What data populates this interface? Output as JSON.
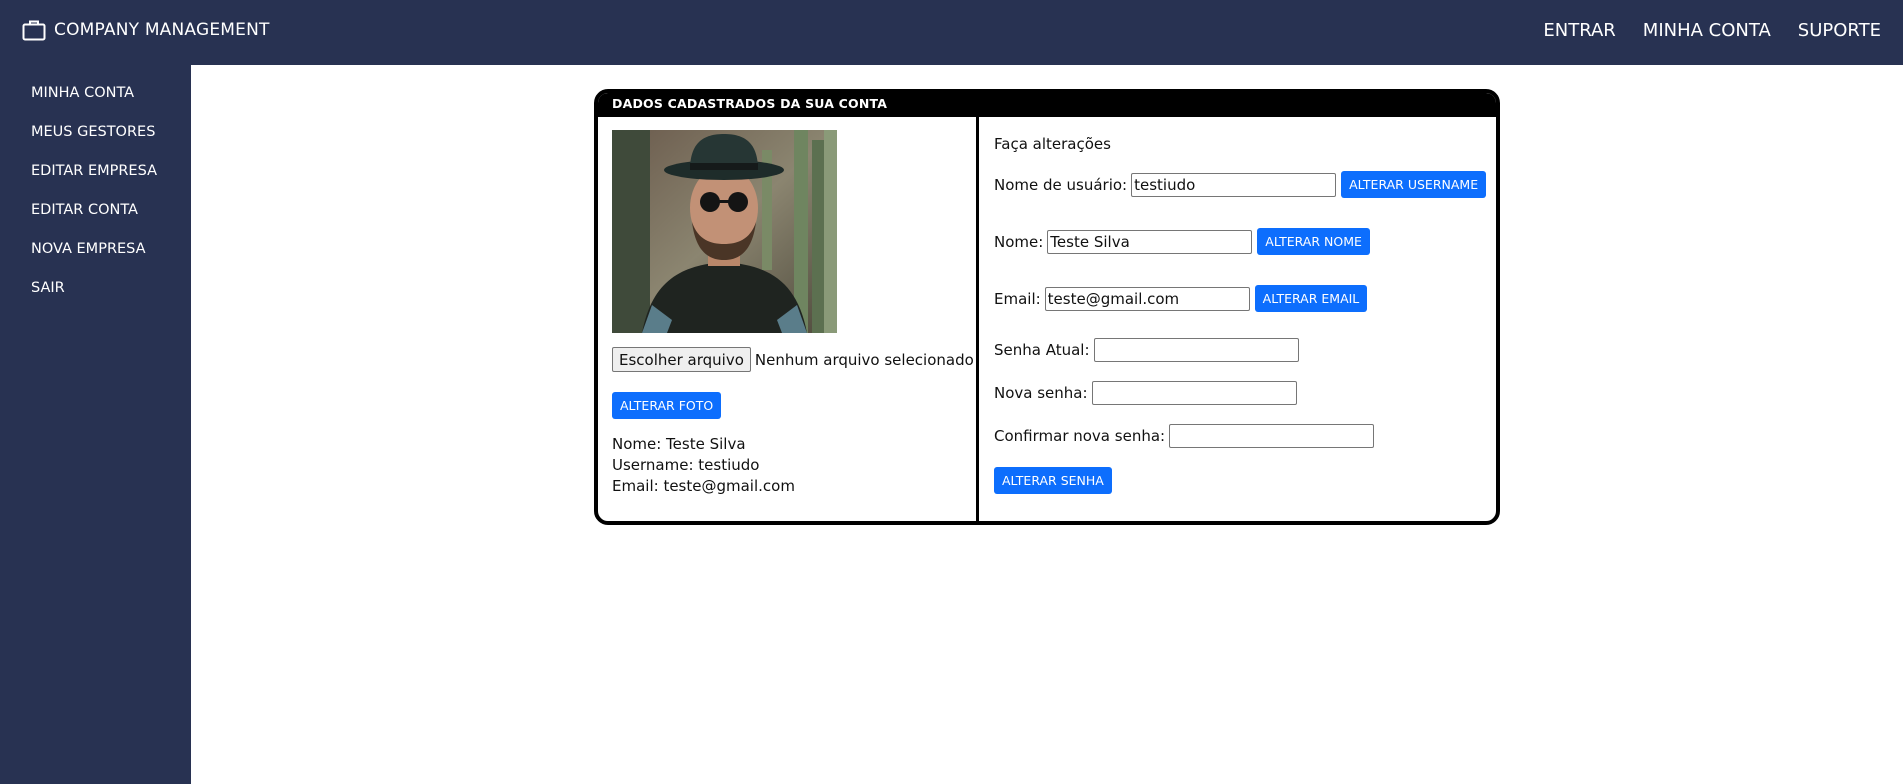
{
  "header": {
    "brand": "COMPANY MANAGEMENT",
    "brand_icon": "briefcase-icon",
    "nav": [
      "ENTRAR",
      "MINHA CONTA",
      "SUPORTE"
    ]
  },
  "sidebar": {
    "items": [
      "MINHA CONTA",
      "MEUS GESTORES",
      "EDITAR EMPRESA",
      "EDITAR CONTA",
      "NOVA EMPRESA",
      "SAIR"
    ]
  },
  "card": {
    "title": "DADOS CADASTRADOS DA SUA CONTA",
    "photo": {
      "file_button": "Escolher arquivo",
      "file_status": "Nenhum arquivo selecionado",
      "submit_label": "ALTERAR FOTO"
    },
    "info": {
      "nome": "Nome: Teste Silva",
      "username": "Username: testiudo",
      "email": "Email: teste@gmail.com"
    },
    "form": {
      "title": "Faça alterações",
      "username_label": "Nome de usuário:",
      "username_value": "testiudo",
      "username_button": "ALTERAR USERNAME",
      "name_label": "Nome:",
      "name_value": "Teste Silva",
      "name_button": "ALTERAR NOME",
      "email_label": "Email:",
      "email_value": "teste@gmail.com",
      "email_button": "ALTERAR EMAIL",
      "current_password_label": "Senha Atual:",
      "new_password_label": "Nova senha:",
      "confirm_password_label": "Confirmar nova senha:",
      "password_button": "ALTERAR SENHA"
    }
  },
  "colors": {
    "nav_bg": "#283252",
    "button_blue": "#0d6efd",
    "card_border": "#000000"
  }
}
